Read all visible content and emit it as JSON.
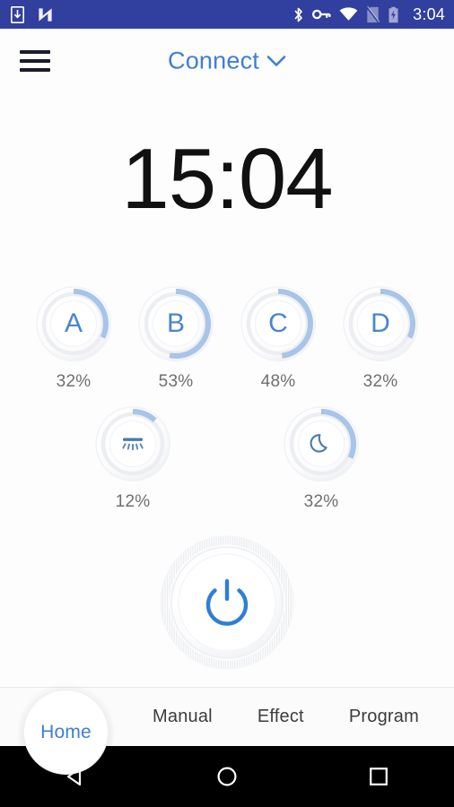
{
  "status_bar": {
    "background_color": "#313F9E",
    "clock": "3:04",
    "left_icons": [
      "download-icon",
      "nexus-n-icon"
    ],
    "right_icons": [
      "bluetooth-icon",
      "vpn-key-icon",
      "wifi-icon",
      "no-sim-icon",
      "battery-charging-icon"
    ]
  },
  "app_bar": {
    "menu_icon": "hamburger-menu-icon",
    "title": "Connect",
    "title_color": "#3D7FD4",
    "dropdown_icon": "chevron-down-icon"
  },
  "clock": {
    "time": "15:04"
  },
  "dials": {
    "accent_color": "#A8C4E8",
    "label_color": "#4A85D0",
    "percent_color": "#6F6F6F",
    "channels": [
      {
        "id": "A",
        "label": "A",
        "kind": "letter",
        "percent": 32,
        "percent_label": "32%"
      },
      {
        "id": "B",
        "label": "B",
        "kind": "letter",
        "percent": 53,
        "percent_label": "53%"
      },
      {
        "id": "C",
        "label": "C",
        "kind": "letter",
        "percent": 48,
        "percent_label": "48%"
      },
      {
        "id": "D",
        "label": "D",
        "kind": "letter",
        "percent": 32,
        "percent_label": "32%"
      }
    ],
    "modes": [
      {
        "id": "daylight",
        "icon": "ceiling-light-icon",
        "kind": "icon",
        "percent": 12,
        "percent_label": "12%"
      },
      {
        "id": "moonlight",
        "icon": "moon-icon",
        "kind": "icon",
        "percent": 32,
        "percent_label": "32%"
      }
    ]
  },
  "power": {
    "icon": "power-icon",
    "color": "#2F7FD1",
    "state": "on"
  },
  "bottom_tabs": {
    "active": "Home",
    "items": [
      {
        "id": "home",
        "label": "Home",
        "active": true
      },
      {
        "id": "manual",
        "label": "Manual",
        "active": false
      },
      {
        "id": "effect",
        "label": "Effect",
        "active": false
      },
      {
        "id": "program",
        "label": "Program",
        "active": false
      }
    ],
    "active_color": "#3D7FD4",
    "inactive_color": "#3C3C3C"
  },
  "android_nav": {
    "background_color": "#000000",
    "buttons": [
      {
        "id": "back",
        "icon": "triangle-back-icon"
      },
      {
        "id": "home",
        "icon": "circle-home-icon"
      },
      {
        "id": "recents",
        "icon": "square-recents-icon"
      }
    ]
  }
}
